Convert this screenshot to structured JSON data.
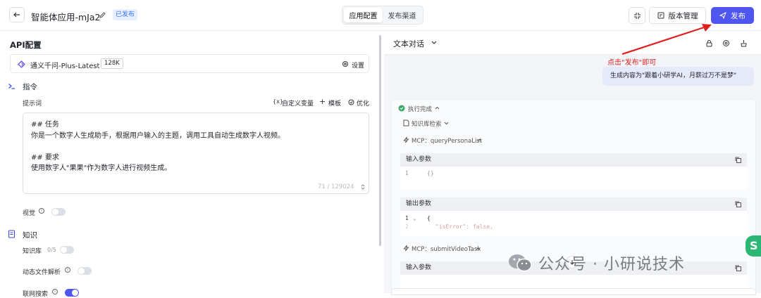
{
  "header": {
    "app_title": "智能体应用-mJa2",
    "status_badge": "已发布",
    "tabs": [
      "应用配置",
      "发布渠道"
    ],
    "version_button": "版本管理",
    "publish_button": "发布"
  },
  "left": {
    "section_title": "API配置",
    "model": {
      "name": "通义千问-Plus-Latest",
      "badge": "128K",
      "settings_label": "设置"
    },
    "instruction": {
      "title": "指令",
      "prompt_label": "提示词",
      "actions": [
        "自定义变量",
        "模板",
        "优化"
      ],
      "lines": [
        "## 任务",
        "你是一个数字人生成助手，根据用户输入的主题，调用工具自动生成数字人视频。",
        "",
        "## 要求",
        "使用数字人\"果果\"作为数字人进行视频生成。"
      ],
      "counter": "71 / 129024"
    },
    "vision_label": "视觉",
    "knowledge": {
      "title": "知识",
      "kb_label": "知识库",
      "kb_count": "0/5",
      "dynamic_label": "动态文件解析",
      "search_label": "联网搜索"
    }
  },
  "right": {
    "mode_label": "文本对话",
    "annotation": "点击\"发布\"即可",
    "user_message": "生成内容为\"跟着小研学AI，月薪过万不是梦\"",
    "run_status": "执行完成",
    "kb_search": "知识库检索",
    "mcp1": "MCP：queryPersonaList",
    "mcp2": "MCP：submitVideoTask",
    "input_params": "输入参数",
    "output_params": "输出参数",
    "code1": [
      "1",
      "{}"
    ],
    "code2": [
      "1",
      "{",
      "2",
      "\"isError\": false,"
    ],
    "watermark": "公众号 · 小研说技术"
  },
  "colors": {
    "accent": "#4f56f0",
    "annotation": "#e02020"
  }
}
